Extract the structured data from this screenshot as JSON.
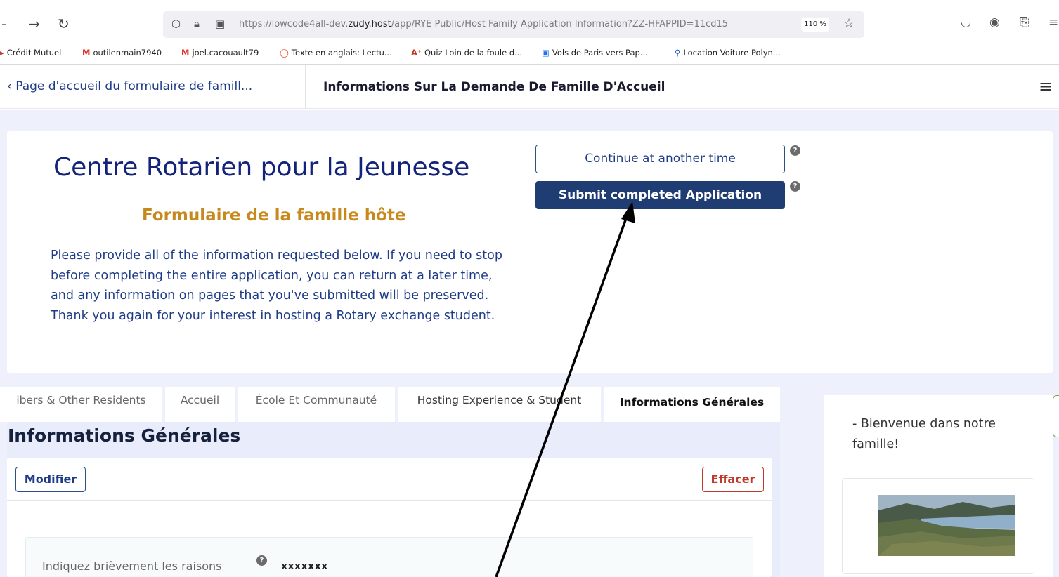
{
  "browser": {
    "nav": {
      "back": "←",
      "forward": "→",
      "reload": "↻"
    },
    "url_prefix": "https://lowcode4all-dev.",
    "url_host": "zudy.host",
    "url_path": "/app/RYE Public/Host Family Application Information?ZZ-HFAPPID=11cd15",
    "zoom": "110 %",
    "bookmarks": [
      {
        "icon": "▸",
        "label": "Crédit Mutuel",
        "color": "#c0392b"
      },
      {
        "icon": "M",
        "label": "outilenmain7940",
        "color": "#d93025"
      },
      {
        "icon": "M",
        "label": "joel.cacouault79",
        "color": "#d93025"
      },
      {
        "icon": "◯",
        "label": "Texte en anglais: Lectu...",
        "color": "#e8401c"
      },
      {
        "icon": "A⁺",
        "label": "Quiz Loin de la foule d...",
        "color": "#c0392b"
      },
      {
        "icon": "▣",
        "label": "Vols de Paris vers Pap...",
        "color": "#1a73e8"
      },
      {
        "icon": "⚲",
        "label": "Location Voiture Polyn...",
        "color": "#1a56c4"
      }
    ]
  },
  "header": {
    "back_label": "‹ Page d'accueil du formulaire de famill...",
    "title": "Informations Sur La Demande De Famille D'Accueil"
  },
  "intro": {
    "title": "Centre Rotarien pour la Jeunesse",
    "subtitle": "Formulaire de la famille hôte",
    "text": "Please provide all of the information requested below. If you need to stop before completing the entire application, you can return at a later time, and any information on pages that you've submitted will be preserved. Thank you again for your interest in hosting a Rotary exchange student.",
    "continue_label": "Continue at another time",
    "submit_label": "Submit completed Application"
  },
  "tabs": [
    {
      "label": "ibers & Other Residents",
      "active": false
    },
    {
      "label": "Accueil",
      "active": false
    },
    {
      "label": "École Et Communauté",
      "active": false
    },
    {
      "label": "Hosting Experience & Student",
      "active": false
    },
    {
      "label": "Informations Générales",
      "active": true
    }
  ],
  "section": {
    "title": "Informations Générales",
    "modify_label": "Modifier",
    "clear_label": "Effacer",
    "field_label": "Indiquez brièvement les raisons",
    "field_value": "xxxxxxx"
  },
  "side": {
    "text": "- Bienvenue dans notre famille!"
  },
  "colors": {
    "brand_navy": "#1f3c73",
    "accent_gold": "#c8891c",
    "danger": "#c0392b"
  }
}
